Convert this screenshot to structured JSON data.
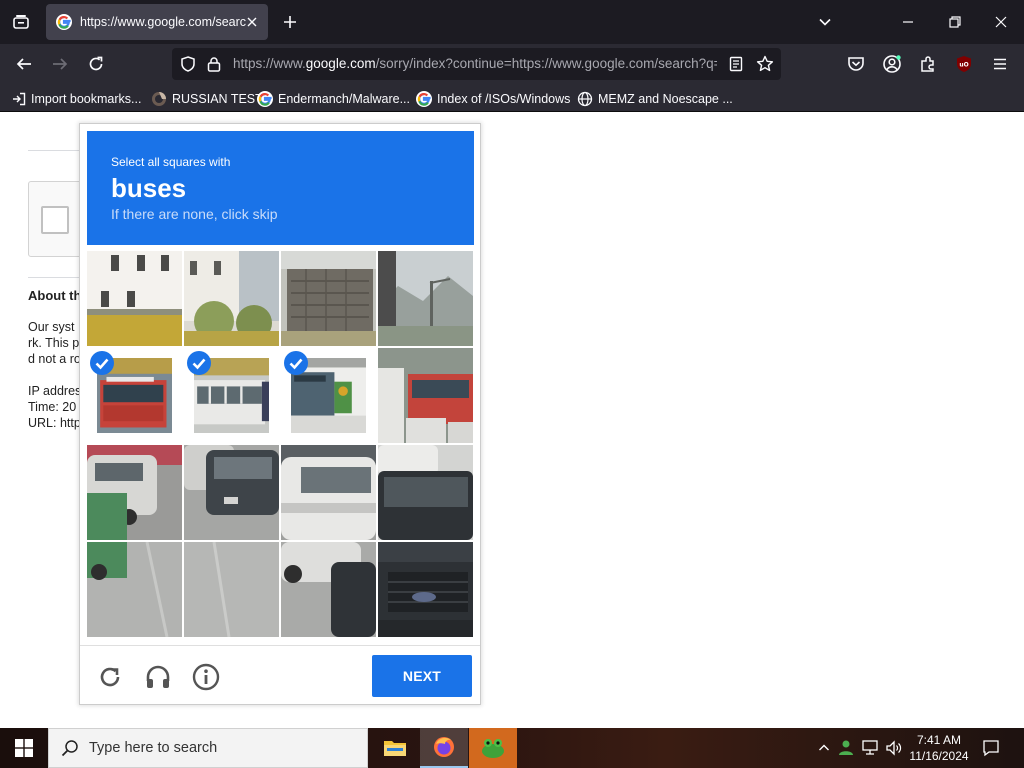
{
  "browser": {
    "tab": {
      "title": "https://www.google.com/search?q="
    },
    "url": {
      "prefix": "https://www.",
      "domain": "google.com",
      "rest": "/sorry/index?continue=https://www.google.com/search?q="
    },
    "bookmarks": [
      {
        "label": "Import bookmarks..."
      },
      {
        "label": "RUSSIAN TEST"
      },
      {
        "label": "Endermanch/Malware..."
      },
      {
        "label": "Index of /ISOs/Windows"
      },
      {
        "label": "MEMZ and Noescape ..."
      }
    ],
    "colors": {
      "accent": "#1a73e8",
      "toolbar": "#2b2a33",
      "tabstrip": "#1c1b22"
    }
  },
  "page": {
    "about_heading": "About th",
    "lines": [
      "Our syst",
      "rk. This p",
      "d not a ro",
      "IP addres",
      "Time: 20",
      "URL: http"
    ]
  },
  "captcha": {
    "instruction": "Select all squares with",
    "target": "buses",
    "hint": "If there are none, click skip",
    "selected_tiles": [
      4,
      5,
      6
    ],
    "next_label": "NEXT"
  },
  "taskbar": {
    "search_placeholder": "Type here to search",
    "time": "7:41 AM",
    "date": "11/16/2024"
  }
}
